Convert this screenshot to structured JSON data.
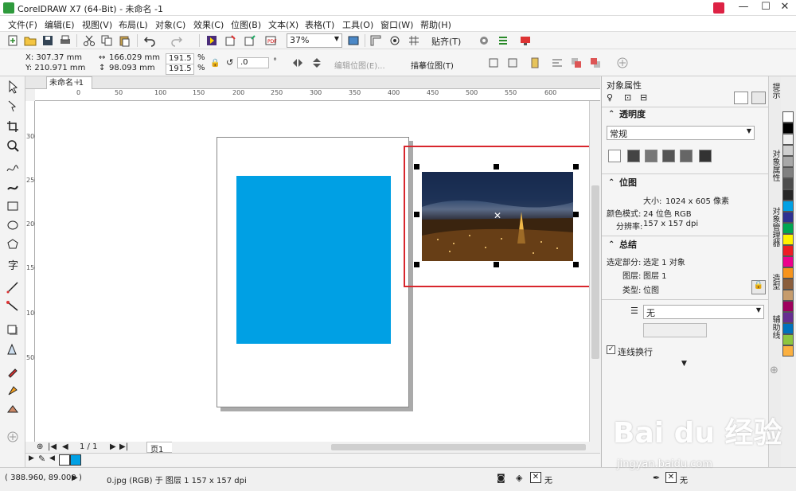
{
  "window": {
    "title": "CorelDRAW X7 (64-Bit) - 未命名 -1",
    "minimize": "—",
    "maximize": "☐",
    "close": "✕"
  },
  "menu": [
    "文件(F)",
    "编辑(E)",
    "视图(V)",
    "布局(L)",
    "对象(C)",
    "效果(C)",
    "位图(B)",
    "文本(X)",
    "表格(T)",
    "工具(O)",
    "窗口(W)",
    "帮助(H)"
  ],
  "toolbar": {
    "zoom_value": "37%",
    "snap_label": "贴齐(T)"
  },
  "propbar": {
    "x": "X: 307.37 mm",
    "y": "Y: 210.971 mm",
    "width": "166.029 mm",
    "height": "98.093 mm",
    "scale_w": "191.5",
    "scale_h": "191.5",
    "percent": "%",
    "rotation": ".0",
    "degree": "°",
    "edit_bitmap": "编辑位图(E)...",
    "trace_bitmap": "描摹位图(T)"
  },
  "document": {
    "tab": "未命名 -1",
    "page_counter": "1 / 1",
    "page_tab": "页1"
  },
  "ruler": {
    "h_ticks": [
      "0",
      "50",
      "100",
      "150",
      "200",
      "250",
      "300",
      "350",
      "400",
      "450",
      "500",
      "550",
      "600"
    ],
    "v_ticks": [
      "300",
      "250",
      "200",
      "150",
      "100",
      "50"
    ]
  },
  "docker": {
    "title": "对象属性",
    "transparency": {
      "header": "透明度",
      "mode": "常规"
    },
    "bitmap": {
      "header": "位图",
      "size_label": "大小:",
      "size_value": "1024 x 605 像素",
      "color_label": "颜色模式:",
      "color_value": "24 位色 RGB",
      "res_label": "分辨率:",
      "res_value": "157 x 157 dpi"
    },
    "summary": {
      "header": "总结",
      "selected_label": "选定部分:",
      "selected_value": "选定 1 对象",
      "layer_label": "图层:",
      "layer_value": "图层 1",
      "type_label": "类型:",
      "type_value": "位图"
    },
    "wrap_value": "无",
    "wrap_checkbox": "连线换行"
  },
  "vtabs": [
    "提示",
    "对象属性",
    "对象管理器",
    "造型",
    "辅助线"
  ],
  "palette_colors": [
    "#ffffff",
    "#000000",
    "#f0f0f0",
    "#cfcfcf",
    "#a8a8a8",
    "#808080",
    "#4d4d4d",
    "#262626",
    "#00a0e4",
    "#2e3192",
    "#00a651",
    "#fff200",
    "#ed1c24",
    "#ec008c",
    "#f7941d",
    "#8b5e3c",
    "#c69c6d",
    "#9e005d",
    "#662d91",
    "#0072bc",
    "#8dc63f",
    "#fbb040"
  ],
  "status": {
    "coords": "( 388.960, 89.000 )",
    "info": "0.jpg (RGB) 于 图层 1 157 x 157 dpi",
    "fill_none": "无",
    "outline_none": "无"
  },
  "watermark": {
    "logo": "Bai du 经验",
    "url": "jingyan.baidu.com"
  }
}
